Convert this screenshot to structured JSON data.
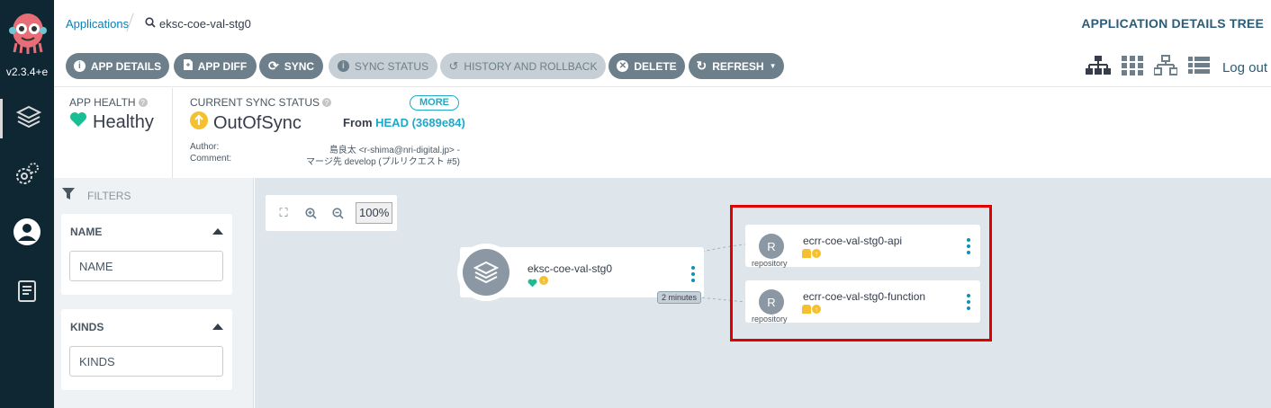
{
  "nav": {
    "version": "v2.3.4+e",
    "items": [
      "applications-icon",
      "settings-icon",
      "user-icon",
      "docs-icon"
    ]
  },
  "breadcrumb": {
    "root": "Applications",
    "current": "eksc-coe-val-stg0"
  },
  "view_title": "APPLICATION DETAILS TREE",
  "toolbar": {
    "app_details": "APP DETAILS",
    "app_diff": "APP DIFF",
    "sync": "SYNC",
    "sync_status": "SYNC STATUS",
    "history": "HISTORY AND ROLLBACK",
    "delete": "DELETE",
    "refresh": "REFRESH",
    "logout": "Log out"
  },
  "status": {
    "health_label": "APP HEALTH",
    "health_value": "Healthy",
    "sync_label": "CURRENT SYNC STATUS",
    "sync_value": "OutOfSync",
    "more": "MORE",
    "from_label": "From",
    "from_rev": "HEAD (3689e84)",
    "author_label": "Author:",
    "author_value": "島良太 <r-shima@nri-digital.jp> -",
    "comment_label": "Comment:",
    "comment_value": "マージ先 develop (プルリクエスト #5)"
  },
  "filters": {
    "title": "FILTERS",
    "name_header": "NAME",
    "name_placeholder": "NAME",
    "kinds_header": "KINDS",
    "kinds_placeholder": "KINDS"
  },
  "graph": {
    "zoom_pct": "100%",
    "app_name": "eksc-coe-val-stg0",
    "duration": "2 minutes",
    "resources": [
      {
        "letter": "R",
        "kind": "repository",
        "name": "ecrr-coe-val-stg0-api"
      },
      {
        "letter": "R",
        "kind": "repository",
        "name": "ecrr-coe-val-stg0-function"
      }
    ]
  },
  "colors": {
    "nav_bg": "#0f2733",
    "button": "#6d7f8b",
    "button_disabled": "#c6cfd5",
    "healthy": "#18be94",
    "out_of_sync": "#f4c030",
    "accent": "#1fa8c6",
    "highlight": "#e00000"
  }
}
